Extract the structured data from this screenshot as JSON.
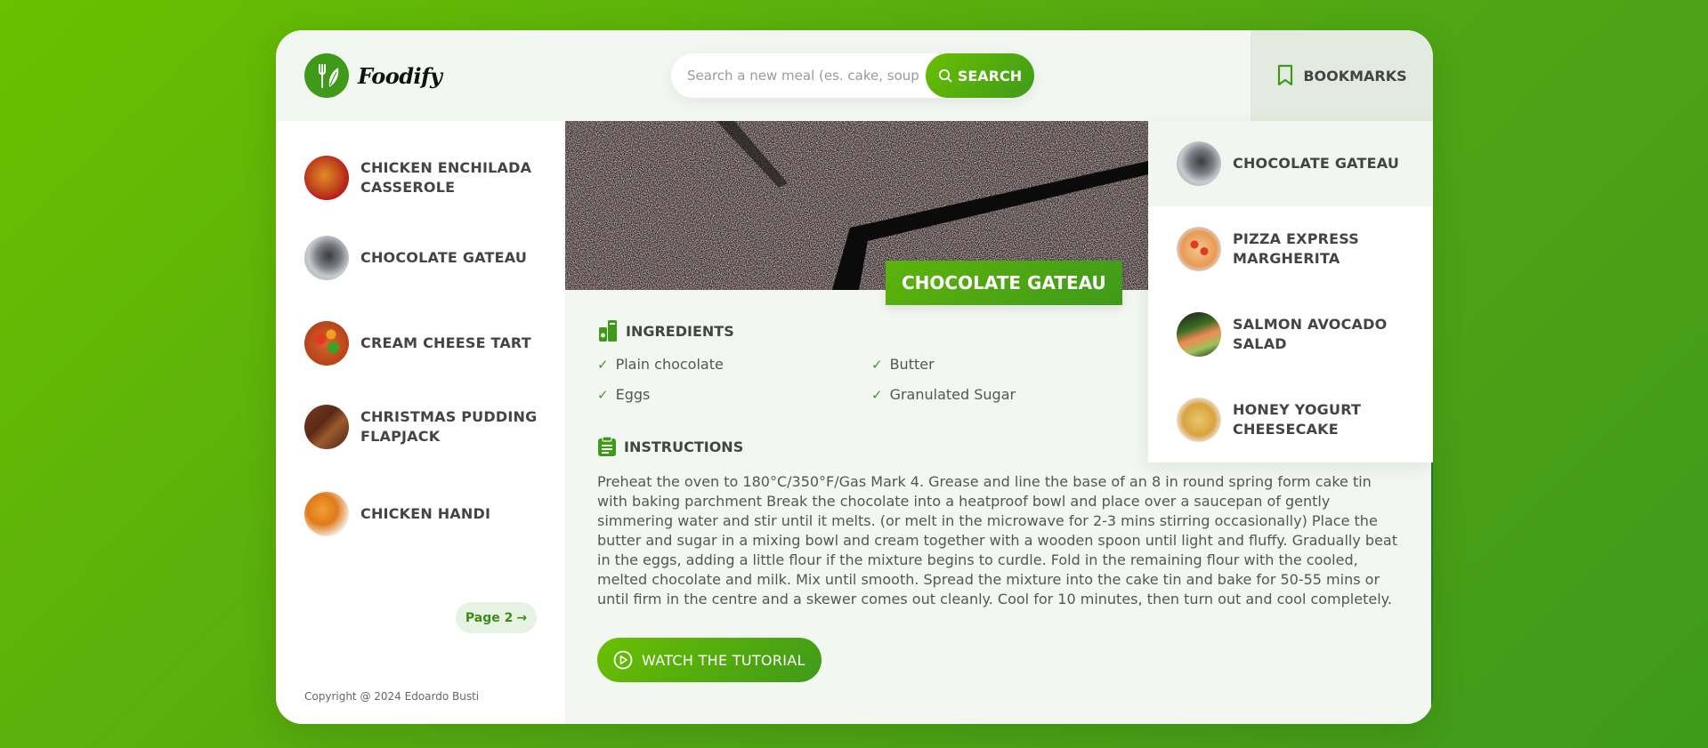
{
  "brand": {
    "name": "Foodify"
  },
  "search": {
    "placeholder": "Search a new meal (es. cake, soup)",
    "button_label": "SEARCH"
  },
  "bookmarks_button": {
    "label": "BOOKMARKS"
  },
  "sidebar": {
    "results": [
      {
        "line1": "CHICKEN ENCHILADA",
        "line2": "CASSEROLE",
        "thumb": "enchilada"
      },
      {
        "line1": "CHOCOLATE GATEAU",
        "line2": "",
        "thumb": "gateau"
      },
      {
        "line1": "CREAM CHEESE TART",
        "line2": "",
        "thumb": "tart"
      },
      {
        "line1": "CHRISTMAS PUDDING",
        "line2": "FLAPJACK",
        "thumb": "flapjack"
      },
      {
        "line1": "CHICKEN HANDI",
        "line2": "",
        "thumb": "handi"
      }
    ],
    "pagination_label": "Page 2",
    "copyright": "Copyright @ 2024 Edoardo Busti"
  },
  "recipe": {
    "title": "CHOCOLATE GATEAU",
    "ingredients_heading": "INGREDIENTS",
    "ingredients": [
      "Plain chocolate",
      "Butter",
      "Eggs",
      "Granulated Sugar"
    ],
    "instructions_heading": "INSTRUCTIONS",
    "instructions": "Preheat the oven to 180°C/350°F/Gas Mark 4. Grease and line the base of an 8 in round spring form cake tin with baking parchment Break the chocolate into a heatproof bowl and place over a saucepan of gently simmering water and stir until it melts. (or melt in the microwave for 2-3 mins stirring occasionally) Place the butter and sugar in a mixing bowl and cream together with a wooden spoon until light and fluffy. Gradually beat in the eggs, adding a little flour if the mixture begins to curdle. Fold in the remaining flour with the cooled, melted chocolate and milk. Mix until smooth. Spread the mixture into the cake tin and bake for 50-55 mins or until firm in the centre and a skewer comes out cleanly. Cool for 10 minutes, then turn out and cool completely.",
    "tutorial_label": "WATCH THE TUTORIAL"
  },
  "bookmarks": [
    {
      "line1": "CHOCOLATE GATEAU",
      "line2": "",
      "thumb": "gateau",
      "active": true
    },
    {
      "line1": "PIZZA EXPRESS",
      "line2": "MARGHERITA",
      "thumb": "pizza",
      "active": false
    },
    {
      "line1": "SALMON AVOCADO",
      "line2": "SALAD",
      "thumb": "salmon",
      "active": false
    },
    {
      "line1": "HONEY YOGURT",
      "line2": "CHEESECAKE",
      "thumb": "cheesecake",
      "active": false
    }
  ],
  "colors": {
    "accent": "#4fa514",
    "accent_light": "#6abf00",
    "text": "#444444",
    "panel_bg": "#f3f7f2"
  }
}
